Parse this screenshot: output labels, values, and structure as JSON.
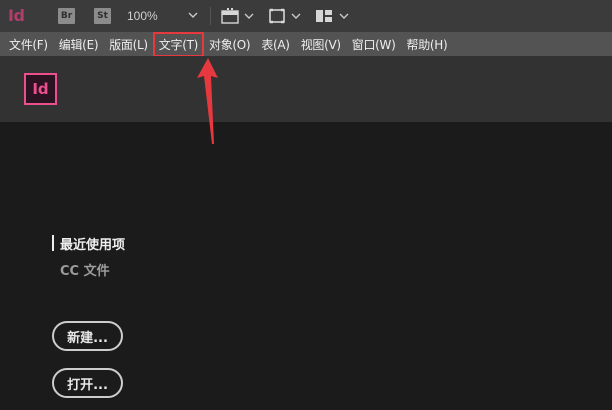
{
  "app": {
    "logo_text": "Id",
    "home_logo_text": "Id"
  },
  "toolbar": {
    "bridge_label": "Br",
    "stock_label": "St",
    "zoom": "100%",
    "icons": [
      "screen-mode-icon",
      "view-options-icon",
      "arrange-documents-icon"
    ]
  },
  "menu": {
    "items": [
      {
        "label": "文件(F)"
      },
      {
        "label": "编辑(E)"
      },
      {
        "label": "版面(L)"
      },
      {
        "label": "文字(T)",
        "highlighted": true
      },
      {
        "label": "对象(O)"
      },
      {
        "label": "表(A)"
      },
      {
        "label": "视图(V)"
      },
      {
        "label": "窗口(W)"
      },
      {
        "label": "帮助(H)"
      }
    ]
  },
  "home": {
    "recent_label": "最近使用项",
    "cc_files_label": "CC 文件",
    "new_button": "新建...",
    "open_button": "打开..."
  },
  "colors": {
    "accent_pink": "#ec4f8e",
    "highlight_red": "#e5393f",
    "menubar_bg": "#535353",
    "content_bg": "#1b1b1b"
  }
}
